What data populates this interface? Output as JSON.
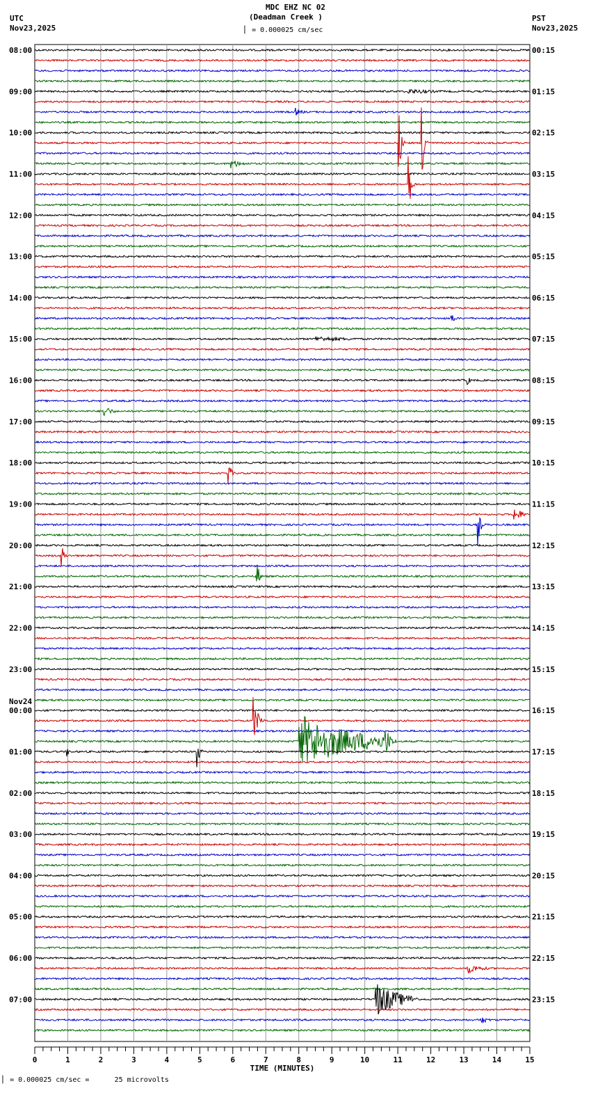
{
  "header": {
    "title": "MDC EHZ NC 02",
    "subtitle": "(Deadman Creek )",
    "left_tz": "UTC",
    "left_date": "Nov23,2025",
    "right_tz": "PST",
    "right_date": "Nov23,2025",
    "scale": "= 0.000025 cm/sec"
  },
  "footer": {
    "scale": "= 0.000025 cm/sec =      25 microvolts"
  },
  "chart_data": {
    "type": "line",
    "title": "MDC EHZ NC 02 (Deadman Creek )",
    "xlabel": "TIME (MINUTES)",
    "xlim": [
      0,
      15
    ],
    "xticks": [
      "0",
      "1",
      "2",
      "3",
      "4",
      "5",
      "6",
      "7",
      "8",
      "9",
      "10",
      "11",
      "12",
      "13",
      "14",
      "15"
    ],
    "traces_per_hour": 4,
    "trace_colors": [
      "#000000",
      "#cc0000",
      "#0000cc",
      "#006600"
    ],
    "left_labels": [
      {
        "row": 0,
        "text": "08:00"
      },
      {
        "row": 4,
        "text": "09:00"
      },
      {
        "row": 8,
        "text": "10:00"
      },
      {
        "row": 12,
        "text": "11:00"
      },
      {
        "row": 16,
        "text": "12:00"
      },
      {
        "row": 20,
        "text": "13:00"
      },
      {
        "row": 24,
        "text": "14:00"
      },
      {
        "row": 28,
        "text": "15:00"
      },
      {
        "row": 32,
        "text": "16:00"
      },
      {
        "row": 36,
        "text": "17:00"
      },
      {
        "row": 40,
        "text": "18:00"
      },
      {
        "row": 44,
        "text": "19:00"
      },
      {
        "row": 48,
        "text": "20:00"
      },
      {
        "row": 52,
        "text": "21:00"
      },
      {
        "row": 56,
        "text": "22:00"
      },
      {
        "row": 60,
        "text": "23:00"
      },
      {
        "row": 64,
        "text": "00:00",
        "date": "Nov24"
      },
      {
        "row": 68,
        "text": "01:00"
      },
      {
        "row": 72,
        "text": "02:00"
      },
      {
        "row": 76,
        "text": "03:00"
      },
      {
        "row": 80,
        "text": "04:00"
      },
      {
        "row": 84,
        "text": "05:00"
      },
      {
        "row": 88,
        "text": "06:00"
      },
      {
        "row": 92,
        "text": "07:00"
      }
    ],
    "right_labels": [
      "00:15",
      "01:15",
      "02:15",
      "03:15",
      "04:15",
      "05:15",
      "06:15",
      "07:15",
      "08:15",
      "09:15",
      "10:15",
      "11:15",
      "12:15",
      "13:15",
      "14:15",
      "15:15",
      "16:15",
      "17:15",
      "18:15",
      "19:15",
      "20:15",
      "21:15",
      "22:15",
      "23:15"
    ],
    "events": [
      {
        "row": 4,
        "minute": 11.3,
        "amp": 4,
        "dur": 1.5
      },
      {
        "row": 9,
        "minute": 11.0,
        "amp": 80,
        "dur": 0.1
      },
      {
        "row": 9,
        "minute": 11.7,
        "amp": 110,
        "dur": 0.1
      },
      {
        "row": 13,
        "minute": 11.3,
        "amp": 70,
        "dur": 0.1
      },
      {
        "row": 6,
        "minute": 7.9,
        "amp": 6,
        "dur": 0.3
      },
      {
        "row": 11,
        "minute": 5.9,
        "amp": 8,
        "dur": 0.5
      },
      {
        "row": 26,
        "minute": 12.6,
        "amp": 20,
        "dur": 0.1
      },
      {
        "row": 28,
        "minute": 8.5,
        "amp": 4,
        "dur": 2
      },
      {
        "row": 32,
        "minute": 13.1,
        "amp": 10,
        "dur": 0.1
      },
      {
        "row": 35,
        "minute": 2.05,
        "amp": 12,
        "dur": 0.3
      },
      {
        "row": 41,
        "minute": 5.85,
        "amp": 30,
        "dur": 0.1
      },
      {
        "row": 45,
        "minute": 14.5,
        "amp": 15,
        "dur": 0.3
      },
      {
        "row": 46,
        "minute": 13.4,
        "amp": 45,
        "dur": 0.1
      },
      {
        "row": 49,
        "minute": 0.8,
        "amp": 25,
        "dur": 0.1
      },
      {
        "row": 51,
        "minute": 6.7,
        "amp": 40,
        "dur": 0.1
      },
      {
        "row": 65,
        "minute": 6.6,
        "amp": 40,
        "dur": 0.2
      },
      {
        "row": 67,
        "minute": 8.0,
        "amp": 40,
        "dur": 2.5
      },
      {
        "row": 67,
        "minute": 10.6,
        "amp": 30,
        "dur": 0.2
      },
      {
        "row": 68,
        "minute": 4.9,
        "amp": 35,
        "dur": 0.1
      },
      {
        "row": 68,
        "minute": 0.95,
        "amp": 12,
        "dur": 0.1
      },
      {
        "row": 89,
        "minute": 13.1,
        "amp": 8,
        "dur": 0.6
      },
      {
        "row": 92,
        "minute": 10.3,
        "amp": 28,
        "dur": 1.0
      },
      {
        "row": 94,
        "minute": 13.5,
        "amp": 7,
        "dur": 0.3
      }
    ]
  }
}
